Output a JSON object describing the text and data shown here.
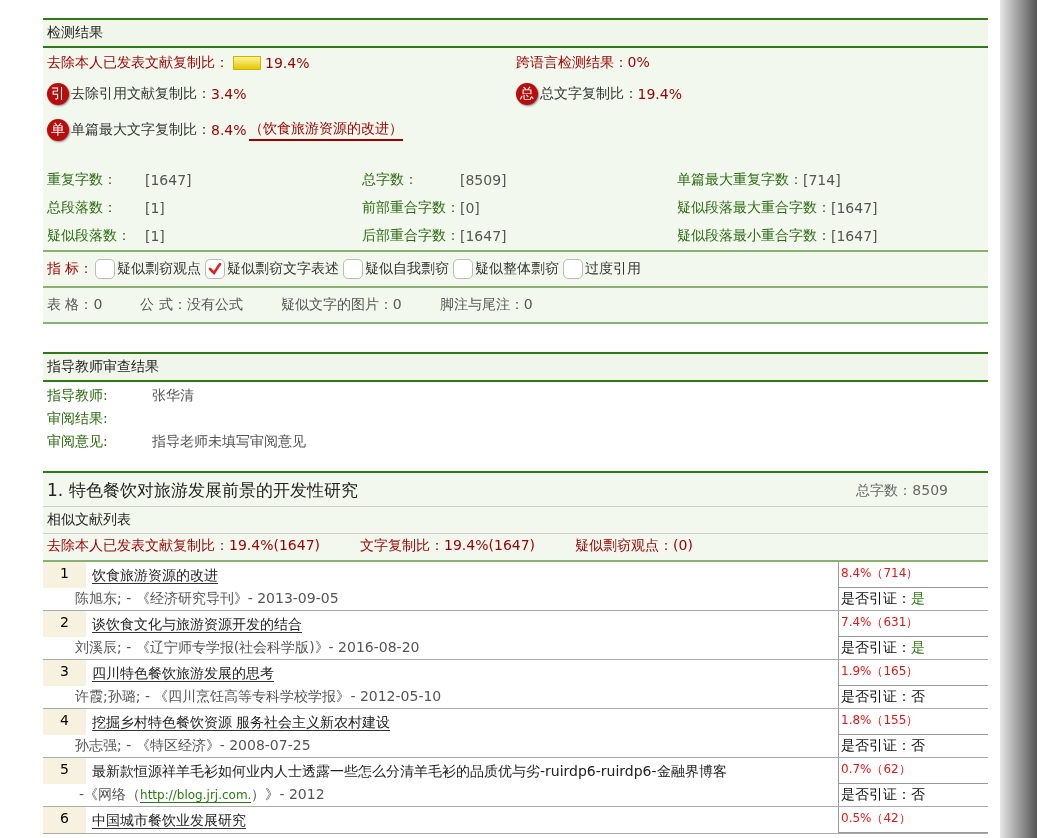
{
  "detection": {
    "title": "检测结果",
    "main_ratio": {
      "label": "去除本人已发表文献复制比：",
      "value": "19.4%"
    },
    "cross_language": {
      "label": "跨语言检测结果：",
      "value": "0%"
    },
    "cited_ratio": {
      "badge": "引",
      "label": "去除引用文献复制比：",
      "value": "3.4%"
    },
    "total_ratio": {
      "badge": "总",
      "label": "总文字复制比：",
      "value": "19.4%"
    },
    "single_ratio": {
      "badge": "单",
      "label": "单篇最大文字复制比：",
      "value": "8.4%",
      "link": "（饮食旅游资源的改进）"
    },
    "stats": [
      {
        "label": "重复字数：",
        "value": "[1647]"
      },
      {
        "label": "总字数：",
        "value": "[8509]"
      },
      {
        "label": "单篇最大重复字数：",
        "value": "[714]"
      },
      {
        "label": "总段落数：",
        "value": "[1]"
      },
      {
        "label": "前部重合字数：",
        "value": "[0]"
      },
      {
        "label": "疑似段落最大重合字数：",
        "value": "[1647]"
      },
      {
        "label": "疑似段落数：",
        "value": "[1]"
      },
      {
        "label": "后部重合字数：",
        "value": "[1647]"
      },
      {
        "label": "疑似段落最小重合字数：",
        "value": "[1647]"
      }
    ],
    "indicators": {
      "label": "指 标：",
      "items": [
        {
          "label": "疑似剽窃观点",
          "checked": false
        },
        {
          "label": "疑似剽窃文字表述",
          "checked": true
        },
        {
          "label": "疑似自我剽窃",
          "checked": false
        },
        {
          "label": "疑似整体剽窃",
          "checked": false
        },
        {
          "label": "过度引用",
          "checked": false
        }
      ]
    },
    "counts": [
      {
        "label": "表 格：",
        "value": "0"
      },
      {
        "label": "公 式：",
        "value": "没有公式"
      },
      {
        "label": "疑似文字的图片：",
        "value": "0"
      },
      {
        "label": "脚注与尾注：",
        "value": "0"
      }
    ]
  },
  "review": {
    "title": "指导教师审查结果",
    "fields": [
      {
        "label": "指导教师:",
        "value": "张华清"
      },
      {
        "label": "审阅结果:"
      },
      {
        "label": "审阅意见:",
        "value": "指导老师未填写审阅意见"
      }
    ]
  },
  "document": {
    "title": "1. 特色餐饮对旅游发展前景的开发性研究",
    "word_count": "总字数：8509",
    "list_title": "相似文献列表",
    "summary": [
      "去除本人已发表文献复制比：19.4%(1647)",
      "文字复制比：19.4%(1647)",
      "疑似剽窃观点：(0)"
    ],
    "rows": [
      {
        "number": "1",
        "title": "饮食旅游资源的改进",
        "ratio": "8.4%（714）",
        "kind": "plain",
        "source": "陈旭东; - 《经济研究导刊》- 2013-09-05",
        "cited_label": "是否引证：",
        "cited_value": "是",
        "cited": true
      },
      {
        "number": "2",
        "title": "谈饮食文化与旅游资源开发的结合",
        "ratio": "7.4%（631）",
        "kind": "plain",
        "source": "刘溪辰; - 《辽宁师专学报(社会科学版)》- 2016-08-20",
        "cited_label": "是否引证：",
        "cited_value": "是",
        "cited": true
      },
      {
        "number": "3",
        "title": "四川特色餐饮旅游发展的思考",
        "ratio": "1.9%（165）",
        "kind": "plain",
        "source": "许霞;孙璐; - 《四川烹饪高等专科学校学报》- 2012-05-10",
        "cited_label": "是否引证：",
        "cited_value": "否",
        "cited": false
      },
      {
        "number": "4",
        "title": "挖掘乡村特色餐饮资源  服务社会主义新农村建设",
        "ratio": "1.8%（155）",
        "kind": "plain",
        "source": "孙志强; - 《特区经济》- 2008-07-25",
        "cited_label": "是否引证：",
        "cited_value": "否",
        "cited": false
      },
      {
        "number": "5",
        "title": "最新款恒源祥羊毛衫如何业内人士透露一些怎么分清羊毛衫的品质优与劣-ruirdp6-ruirdp6-金融界博客",
        "ratio": "0.7%（62）",
        "kind": "link",
        "source": "-《网络（",
        "link": "http://blog.jrj.com.",
        "source_end": "）》-  2012",
        "cited_label": "是否引证：",
        "cited_value": "否",
        "cited": false
      },
      {
        "number": "6",
        "title": "中国城市餐饮业发展研究",
        "ratio": "0.5%（42）",
        "kind": "partial"
      }
    ]
  }
}
